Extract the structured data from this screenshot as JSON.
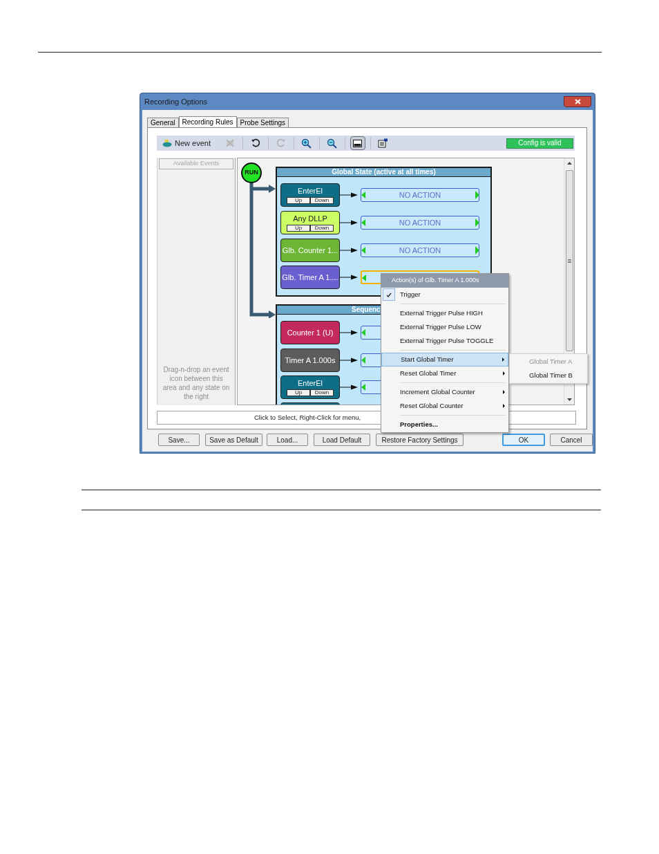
{
  "window": {
    "title": "Recording Options"
  },
  "tabs": [
    {
      "label": "General",
      "selected": false
    },
    {
      "label": "Recording Rules",
      "selected": true
    },
    {
      "label": "Probe Settings",
      "selected": false
    }
  ],
  "toolbar": {
    "new_event": "New event",
    "tools": [
      {
        "kind": "delete",
        "disabled": true
      },
      {
        "kind": "undo",
        "disabled": false
      },
      {
        "kind": "redo",
        "disabled": true
      },
      {
        "kind": "zoom-in",
        "disabled": false
      },
      {
        "kind": "zoom-out",
        "disabled": false
      },
      {
        "kind": "layout",
        "disabled": false,
        "pressed": true
      },
      {
        "kind": "properties",
        "disabled": false
      }
    ],
    "status": "Config is valid"
  },
  "events_panel": {
    "title": "Available Events",
    "hint": "Drag-n-drop an event icon between this area and any state on the right"
  },
  "diagram": {
    "start": "RUN",
    "states": [
      {
        "title": "Global State (active at all times)",
        "rows": [
          {
            "event": "EnterEl",
            "color": "#0f6e87",
            "buttons": [
              "Up",
              "Down"
            ],
            "action": "NO ACTION",
            "selected": false
          },
          {
            "event": "Any DLLP",
            "color": "#ccff66",
            "buttons": [
              "Up",
              "Down"
            ],
            "action": "NO ACTION",
            "selected": false
          },
          {
            "event": "Glb. Counter 1...",
            "color": "#6cb535",
            "action": "NO ACTION",
            "selected": false
          },
          {
            "event": "Glb. Timer A 1....",
            "color": "#6a5fd0",
            "selected": true
          }
        ]
      },
      {
        "title": "Sequenc",
        "rows": [
          {
            "event": "Counter 1 (U)",
            "color": "#c3285f",
            "selected": false
          },
          {
            "event": "Timer A 1.000s",
            "color": "#5c5c5c",
            "selected": false
          },
          {
            "event": "EnterEl",
            "color": "#0f6e87",
            "buttons": [
              "Up",
              "Down"
            ],
            "selected": false
          },
          {
            "color": "#0f6e87"
          }
        ]
      }
    ]
  },
  "status_bar": "Click to Select, Right-Click for menu,",
  "buttons": [
    {
      "label": "Save...",
      "focused": false
    },
    {
      "label": "Save as Default",
      "focused": false
    },
    {
      "label": "Load...",
      "focused": false
    },
    {
      "label": "Load Default",
      "focused": false
    },
    {
      "label": "Restore Factory Settings",
      "focused": false
    },
    {
      "label": "OK",
      "focused": true
    },
    {
      "label": "Cancel",
      "focused": false
    }
  ],
  "context_menu": {
    "title": "Action(s) of Glb. Timer A 1.000s",
    "items": [
      {
        "kind": "item",
        "label": "Trigger",
        "checked": true,
        "submenu": false,
        "selected": false
      },
      {
        "kind": "separator"
      },
      {
        "kind": "item",
        "label": "External Trigger Pulse HIGH",
        "checked": false,
        "submenu": false,
        "selected": false
      },
      {
        "kind": "item",
        "label": "External Trigger Pulse LOW",
        "checked": false,
        "submenu": false,
        "selected": false
      },
      {
        "kind": "item",
        "label": "External Trigger Pulse TOGGLE",
        "checked": false,
        "submenu": false,
        "selected": false
      },
      {
        "kind": "separator"
      },
      {
        "kind": "item",
        "label": "Start Global Timer",
        "checked": false,
        "submenu": true,
        "selected": true
      },
      {
        "kind": "item",
        "label": "Reset Global Timer",
        "checked": false,
        "submenu": true,
        "selected": false
      },
      {
        "kind": "separator"
      },
      {
        "kind": "item",
        "label": "Increment Global Counter",
        "checked": false,
        "submenu": true,
        "selected": false
      },
      {
        "kind": "item",
        "label": "Reset Global Counter",
        "checked": false,
        "submenu": true,
        "selected": false
      },
      {
        "kind": "separator"
      },
      {
        "kind": "item",
        "label": "Properties...",
        "checked": false,
        "submenu": false,
        "selected": false,
        "bold": true
      }
    ]
  },
  "submenu": {
    "items": [
      {
        "label": "Global Timer A",
        "disabled": true
      },
      {
        "label": "Global Timer B",
        "disabled": false
      }
    ]
  }
}
